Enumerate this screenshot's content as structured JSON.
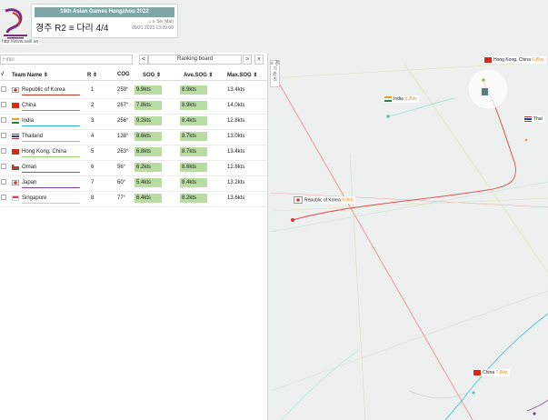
{
  "header": {
    "event_title": "19th Asian Games Hangzhou 2022",
    "race_title": "경주 R2 ≡ 다리 4/4",
    "user": "⌂ ≡ Ser Man",
    "datetime": "09/21 2023 13:09:00",
    "site_url": "http://www.sailI.an"
  },
  "panel": {
    "filter_placeholder": "Filter",
    "prev": "<",
    "board_title": "Ranking board",
    "next": ">",
    "close": "×",
    "side_tab": "≡ 경기 관리"
  },
  "columns": {
    "check": "√",
    "team": "Team Name ⇕",
    "rank": "R ⇕",
    "cog": "COG",
    "sog": "SOG ⇕",
    "avg": "Ave.SOG ⇕",
    "max": "Max.SOG ⇕"
  },
  "rows": [
    {
      "team": "Republic of Korea",
      "rank": "1",
      "cog": "259°",
      "sog": "9.9kts",
      "avg": "8.9kts",
      "max": "13.4kts",
      "color": "#c0392b",
      "flag": "korea"
    },
    {
      "team": "China",
      "rank": "2",
      "cog": "267°",
      "sog": "7.8kts",
      "avg": "8.9kts",
      "max": "14.0kts",
      "color": "#2ab0c7",
      "flag": "china"
    },
    {
      "team": "India",
      "rank": "3",
      "cog": "256°",
      "sog": "9.2kts",
      "avg": "8.4kts",
      "max": "12.8kts",
      "color": "#2ab0c7",
      "flag": "india"
    },
    {
      "team": "Thailand",
      "rank": "4",
      "cog": "138°",
      "sog": "8.6kts",
      "avg": "8.7kts",
      "max": "13.0kts",
      "color": "#e8a23a",
      "flag": "thailand"
    },
    {
      "team": "Hong Kong, China",
      "rank": "5",
      "cog": "263°",
      "sog": "6.8kts",
      "avg": "8.7kts",
      "max": "13.4kts",
      "color": "#9bd06b",
      "flag": "hongkong"
    },
    {
      "team": "Oman",
      "rank": "6",
      "cog": "56°",
      "sog": "6.2kts",
      "avg": "8.6kts",
      "max": "12.8kts",
      "color": "#2980b9",
      "flag": "oman"
    },
    {
      "team": "Japan",
      "rank": "7",
      "cog": "60°",
      "sog": "5.4kts",
      "avg": "8.4kts",
      "max": "13.2kts",
      "color": "#7b3fa0",
      "flag": "japan"
    },
    {
      "team": "Singapore",
      "rank": "8",
      "cog": "77°",
      "sog": "6.4kts",
      "avg": "8.2kts",
      "max": "13.6kts",
      "color": "#e0d84a",
      "flag": "singapore"
    }
  ],
  "map_labels": {
    "hongkong": {
      "name": "Hong Kong, China",
      "speed": "6.8kts"
    },
    "india": {
      "name": "India",
      "speed": "9.2kts"
    },
    "thailand": {
      "name": "Thai"
    },
    "korea": {
      "name": "Republic of Korea",
      "speed": "9.9kts"
    },
    "china": {
      "name": "China",
      "speed": "7.8kts"
    }
  },
  "colors": {
    "accent": "#7ea6a7",
    "speed_cell": "#b8dca2",
    "korea_track": "#e05050",
    "china_track": "#55c6d6"
  }
}
